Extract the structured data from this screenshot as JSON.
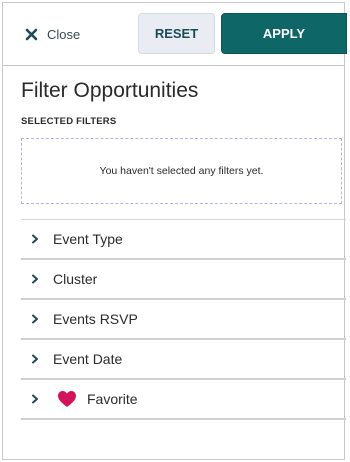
{
  "header": {
    "close_label": "Close",
    "reset_label": "RESET",
    "apply_label": "APPLY"
  },
  "title": "Filter Opportunities",
  "selected_filters": {
    "label": "SELECTED FILTERS",
    "empty_message": "You haven't selected any filters yet."
  },
  "filters": [
    {
      "label": "Event Type"
    },
    {
      "label": "Cluster"
    },
    {
      "label": "Events RSVP"
    },
    {
      "label": "Event Date"
    },
    {
      "label": "Favorite",
      "icon": "heart-icon"
    }
  ],
  "colors": {
    "apply_bg": "#0f6667",
    "reset_bg": "#e9ecf3",
    "heart": "#d6115c",
    "accent_text": "#1b4b56",
    "dashed_border": "#b9b3de"
  }
}
